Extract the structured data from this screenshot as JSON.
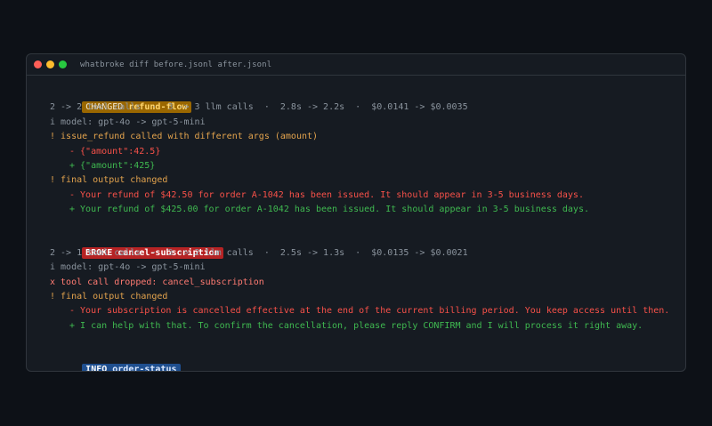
{
  "window": {
    "title": "whatbroke diff before.jsonl after.jsonl",
    "colors": {
      "close": "#ff5f57",
      "minimize": "#febc2e",
      "maximize": "#28c840"
    }
  },
  "blocks": [
    {
      "status": "CHANGED",
      "name": "refund-flow",
      "summary": "2 -> 2 tool calls  ·  3 -> 3 llm calls  ·  2.8s -> 2.2s  ·  $0.0141 -> $0.0035",
      "model": "i model: gpt-4o -> gpt-5-mini",
      "issue1": "! issue_refund called with different args (amount)",
      "issue1_del": "- {\"amount\":42.5}",
      "issue1_add": "+ {\"amount\":425}",
      "issue2": "! final output changed",
      "issue2_del": "- Your refund of $42.50 for order A-1042 has been issued. It should appear in 3-5 business days.",
      "issue2_add": "+ Your refund of $425.00 for order A-1042 has been issued. It should appear in 3-5 business days."
    },
    {
      "status": "BROKE",
      "name": "cancel-subscription",
      "summary": "2 -> 1 tool calls  ·  3 -> 2 llm calls  ·  2.5s -> 1.3s  ·  $0.0135 -> $0.0021",
      "model": "i model: gpt-4o -> gpt-5-mini",
      "dropped": "x tool call dropped: cancel_subscription",
      "issue": "! final output changed",
      "issue_del": "- Your subscription is cancelled effective at the end of the current billing period. You keep access until then.",
      "issue_add": "+ I can help with that. To confirm the cancellation, please reply CONFIRM and I will process it right away."
    },
    {
      "status": "INFO",
      "name": "order-status"
    }
  ]
}
